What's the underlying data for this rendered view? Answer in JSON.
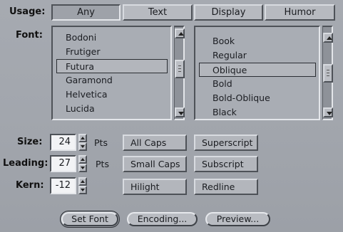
{
  "usage": {
    "label": "Usage:",
    "tabs": [
      {
        "label": "Any",
        "active": true
      },
      {
        "label": "Text",
        "active": false
      },
      {
        "label": "Display",
        "active": false
      },
      {
        "label": "Humor",
        "active": false
      }
    ]
  },
  "font": {
    "label": "Font:",
    "families": [
      "Bodoni",
      "Frutiger",
      "Futura",
      "Garamond",
      "Helvetica",
      "Lucida"
    ],
    "selected_family": "Futura",
    "styles": [
      "Book",
      "Regular",
      "Oblique",
      "Bold",
      "Bold-Oblique",
      "Black"
    ],
    "selected_style": "Oblique"
  },
  "size": {
    "label": "Size:",
    "value": "24",
    "unit": "Pts"
  },
  "leading": {
    "label": "Leading:",
    "value": "27",
    "unit": "Pts"
  },
  "kern": {
    "label": "Kern:",
    "value": "-12"
  },
  "toggles": {
    "all_caps": "All Caps",
    "superscript": "Superscript",
    "small_caps": "Small Caps",
    "subscript": "Subscript",
    "hilight": "Hilight",
    "redline": "Redline"
  },
  "actions": {
    "set_font": "Set Font",
    "encoding": "Encoding...",
    "preview": "Preview..."
  },
  "icons": {
    "scroll_up": "scroll-up-arrow-icon",
    "scroll_down": "scroll-down-arrow-icon",
    "step_up": "stepper-up-arrow-icon",
    "step_down": "stepper-down-arrow-icon"
  }
}
